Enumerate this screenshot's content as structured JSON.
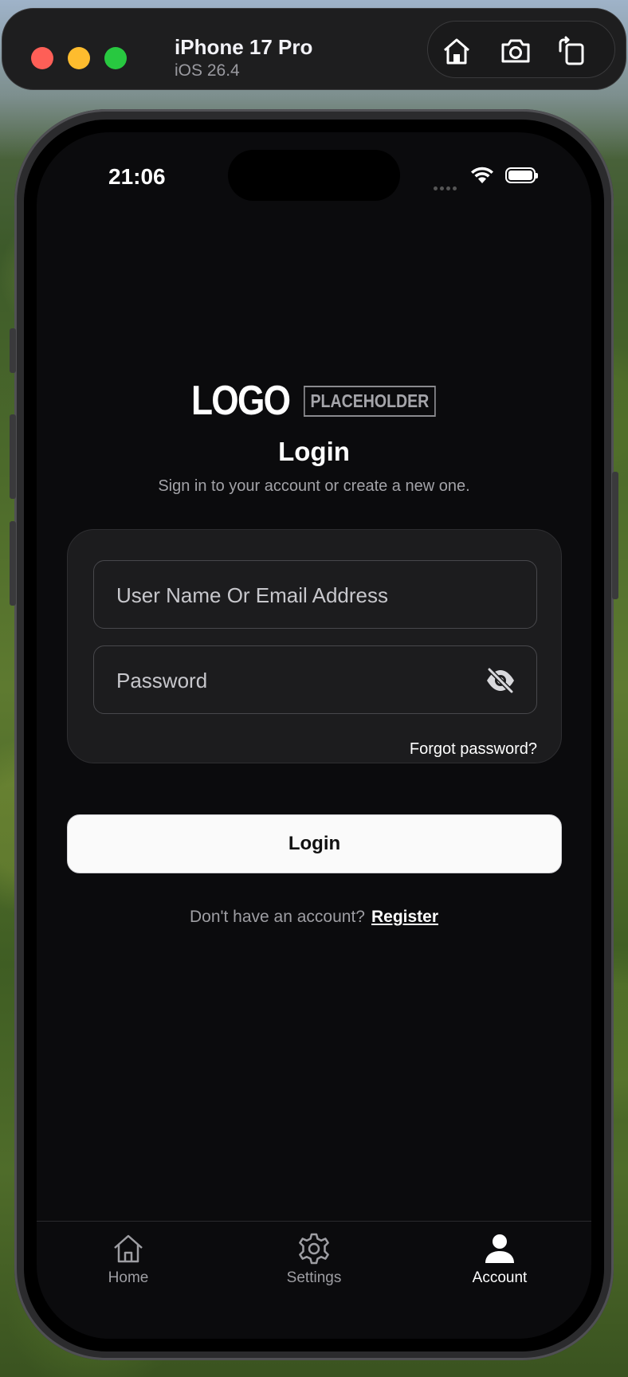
{
  "simulator": {
    "device_name": "iPhone 17 Pro",
    "os_version": "iOS 26.4",
    "controls": [
      "home-icon",
      "screenshot-icon",
      "rotate-icon"
    ]
  },
  "status_bar": {
    "time": "21:06"
  },
  "logo": {
    "main": "LOGO",
    "sub": "PLACEHOLDER"
  },
  "login": {
    "title": "Login",
    "subtitle": "Sign in to your account or create a new one.",
    "username_placeholder": "User Name Or Email Address",
    "username_value": "",
    "password_placeholder": "Password",
    "password_value": "",
    "forgot_password": "Forgot password?",
    "login_button": "Login",
    "no_account_text": "Don't have an account?",
    "register_link": "Register"
  },
  "tabbar": {
    "items": [
      {
        "label": "Home",
        "icon": "home-icon",
        "active": false
      },
      {
        "label": "Settings",
        "icon": "gear-icon",
        "active": false
      },
      {
        "label": "Account",
        "icon": "person-icon",
        "active": true
      }
    ]
  },
  "colors": {
    "screen_bg": "#0b0b0d",
    "card_bg": "#1c1c1e",
    "button_bg": "#fafafa",
    "active_tab": "#ffffff",
    "inactive_tab": "#9e9ea3"
  }
}
